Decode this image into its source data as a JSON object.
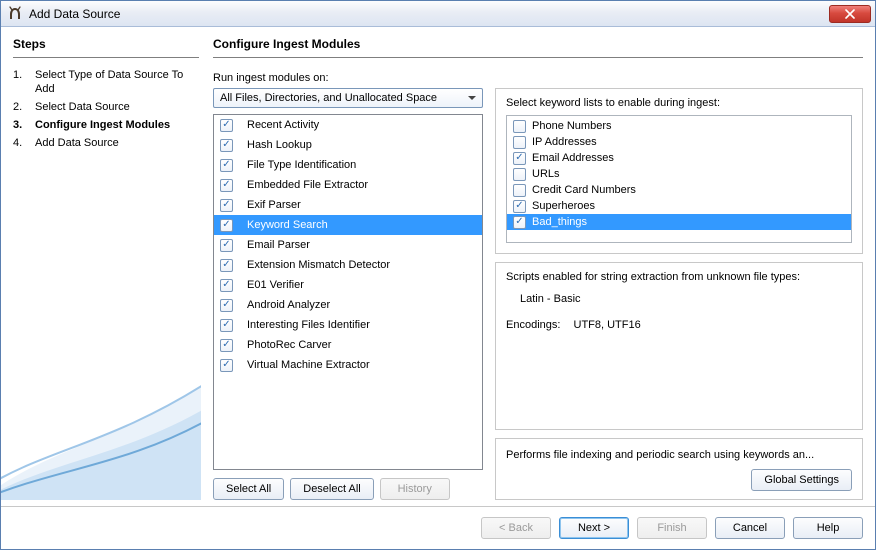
{
  "window": {
    "title": "Add Data Source"
  },
  "steps": {
    "header": "Steps",
    "items": [
      {
        "num": "1.",
        "label": "Select Type of Data Source To Add",
        "current": false
      },
      {
        "num": "2.",
        "label": "Select Data Source",
        "current": false
      },
      {
        "num": "3.",
        "label": "Configure Ingest Modules",
        "current": true
      },
      {
        "num": "4.",
        "label": "Add Data Source",
        "current": false
      }
    ]
  },
  "configure": {
    "header": "Configure Ingest Modules",
    "run_on_label": "Run ingest modules on:",
    "run_on_value": "All Files, Directories, and Unallocated Space",
    "modules": [
      {
        "label": "Recent Activity",
        "checked": true,
        "selected": false
      },
      {
        "label": "Hash Lookup",
        "checked": true,
        "selected": false
      },
      {
        "label": "File Type Identification",
        "checked": true,
        "selected": false
      },
      {
        "label": "Embedded File Extractor",
        "checked": true,
        "selected": false
      },
      {
        "label": "Exif Parser",
        "checked": true,
        "selected": false
      },
      {
        "label": "Keyword Search",
        "checked": true,
        "selected": true
      },
      {
        "label": "Email Parser",
        "checked": true,
        "selected": false
      },
      {
        "label": "Extension Mismatch Detector",
        "checked": true,
        "selected": false
      },
      {
        "label": "E01 Verifier",
        "checked": true,
        "selected": false
      },
      {
        "label": "Android Analyzer",
        "checked": true,
        "selected": false
      },
      {
        "label": "Interesting Files Identifier",
        "checked": true,
        "selected": false
      },
      {
        "label": "PhotoRec Carver",
        "checked": true,
        "selected": false
      },
      {
        "label": "Virtual Machine Extractor",
        "checked": true,
        "selected": false
      }
    ],
    "select_all": "Select All",
    "deselect_all": "Deselect All",
    "history": "History"
  },
  "keywords": {
    "label": "Select keyword lists to enable during ingest:",
    "lists": [
      {
        "label": "Phone Numbers",
        "checked": false,
        "selected": false
      },
      {
        "label": "IP Addresses",
        "checked": false,
        "selected": false
      },
      {
        "label": "Email Addresses",
        "checked": true,
        "selected": false
      },
      {
        "label": "URLs",
        "checked": false,
        "selected": false
      },
      {
        "label": "Credit Card Numbers",
        "checked": false,
        "selected": false
      },
      {
        "label": "Superheroes",
        "checked": true,
        "selected": false
      },
      {
        "label": "Bad_things",
        "checked": true,
        "selected": true
      }
    ],
    "scripts_label": "Scripts enabled for string extraction from unknown file types:",
    "script_name": "Latin - Basic",
    "encodings_label": "Encodings:",
    "encodings_value": "UTF8, UTF16",
    "description": "Performs file indexing and periodic search using keywords an...",
    "global_settings": "Global Settings"
  },
  "footer": {
    "back": "< Back",
    "next": "Next >",
    "finish": "Finish",
    "cancel": "Cancel",
    "help": "Help"
  }
}
